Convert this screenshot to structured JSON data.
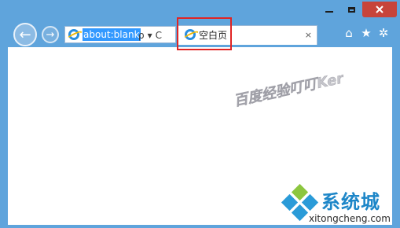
{
  "addressbar": {
    "url": "about:blank"
  },
  "tab": {
    "title": "空白页",
    "close": "×"
  },
  "toolbar": {
    "back": "←",
    "forward": "→",
    "search": "ρ",
    "dropdown": "▾",
    "refresh": "C"
  },
  "tools": {
    "home": "⌂",
    "favorites": "★",
    "settings": "✲"
  },
  "watermark": {
    "text": "百度经验叮叮Ker"
  },
  "brand": {
    "name": "系统城",
    "url": "xitongcheng.com"
  },
  "colors": {
    "frame": "#5fa4dc",
    "close": "#c7443a",
    "highlight": "#e02424",
    "brand": "#1d86c8"
  }
}
